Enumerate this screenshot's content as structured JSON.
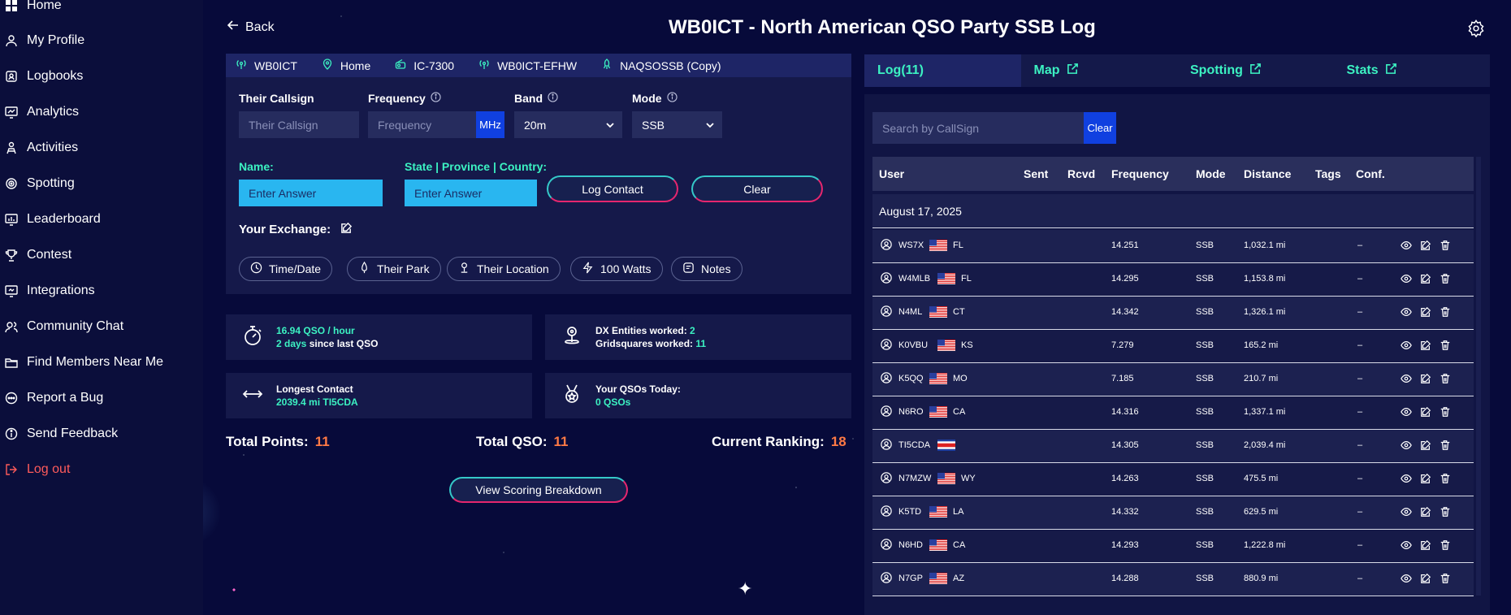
{
  "sidebar": {
    "items": [
      {
        "label": "Home",
        "icon": "home-icon"
      },
      {
        "label": "My Profile",
        "icon": "user-icon"
      },
      {
        "label": "Logbooks",
        "icon": "logbook-icon"
      },
      {
        "label": "Analytics",
        "icon": "analytics-icon"
      },
      {
        "label": "Activities",
        "icon": "activities-icon"
      },
      {
        "label": "Spotting",
        "icon": "spotting-icon"
      },
      {
        "label": "Leaderboard",
        "icon": "leaderboard-icon"
      },
      {
        "label": "Contest",
        "icon": "trophy-icon"
      },
      {
        "label": "Integrations",
        "icon": "integrations-icon"
      },
      {
        "label": "Community Chat",
        "icon": "chat-icon"
      },
      {
        "label": "Find Members Near Me",
        "icon": "folder-icon"
      },
      {
        "label": "Report a Bug",
        "icon": "bug-icon"
      },
      {
        "label": "Send Feedback",
        "icon": "info-icon"
      },
      {
        "label": "Log out",
        "icon": "logout-icon"
      }
    ]
  },
  "header": {
    "back_label": "Back",
    "title": "WB0ICT - North American QSO Party SSB Log"
  },
  "tagbar": {
    "callsign": "WB0ICT",
    "location": "Home",
    "radio": "IC-7300",
    "antenna": "WB0ICT-EFHW",
    "contest": "NAQSOSSB (Copy)"
  },
  "form": {
    "their_callsign_label": "Their Callsign",
    "their_callsign_placeholder": "Their Callsign",
    "frequency_label": "Frequency",
    "frequency_placeholder": "Frequency",
    "frequency_unit": "MHz",
    "band_label": "Band",
    "band_value": "20m",
    "mode_label": "Mode",
    "mode_value": "SSB",
    "name_label": "Name:",
    "name_placeholder": "Enter Answer",
    "state_label": "State | Province | Country:",
    "state_placeholder": "Enter Answer",
    "log_contact_label": "Log Contact",
    "clear_label": "Clear",
    "exchange_label": "Your Exchange:",
    "chips": [
      "Time/Date",
      "Their Park",
      "Their Location",
      "100 Watts",
      "Notes"
    ]
  },
  "stats": {
    "qso_rate": "16.94 QSO / hour",
    "since_days": "2 days",
    "since_suffix": "since last QSO",
    "dx_label": "DX Entities worked:",
    "dx_value": "2",
    "grid_label": "Gridsquares worked:",
    "grid_value": "11",
    "longest_label": "Longest Contact",
    "longest_value": "2039.4 mi TI5CDA",
    "today_label": "Your QSOs Today:",
    "today_value": "0 QSOs"
  },
  "totals": {
    "points_label": "Total Points:",
    "points_value": "11",
    "qso_label": "Total QSO:",
    "qso_value": "11",
    "ranking_label": "Current Ranking:",
    "ranking_value": "18"
  },
  "scoring_button": "View Scoring Breakdown",
  "tabs": [
    {
      "label": "Log(11)"
    },
    {
      "label": "Map"
    },
    {
      "label": "Spotting"
    },
    {
      "label": "Stats"
    }
  ],
  "log": {
    "search_placeholder": "Search by CallSign",
    "search_clear": "Clear",
    "columns": [
      "User",
      "Sent",
      "Rcvd",
      "Frequency",
      "Mode",
      "Distance",
      "Tags",
      "Conf."
    ],
    "date": "August 17, 2025",
    "rows": [
      {
        "call": "WS7X",
        "flag": "us",
        "state": "FL",
        "freq": "14.251",
        "mode": "SSB",
        "dist": "1,032.1 mi",
        "conf": "–"
      },
      {
        "call": "W4MLB",
        "flag": "us",
        "state": "FL",
        "freq": "14.295",
        "mode": "SSB",
        "dist": "1,153.8 mi",
        "conf": "–"
      },
      {
        "call": "N4ML",
        "flag": "us",
        "state": "CT",
        "freq": "14.342",
        "mode": "SSB",
        "dist": "1,326.1 mi",
        "conf": "–"
      },
      {
        "call": "K0VBU",
        "flag": "us",
        "state": "KS",
        "freq": "7.279",
        "mode": "SSB",
        "dist": "165.2 mi",
        "conf": "–"
      },
      {
        "call": "K5QQ",
        "flag": "us",
        "state": "MO",
        "freq": "7.185",
        "mode": "SSB",
        "dist": "210.7 mi",
        "conf": "–"
      },
      {
        "call": "N6RO",
        "flag": "us",
        "state": "CA",
        "freq": "14.316",
        "mode": "SSB",
        "dist": "1,337.1 mi",
        "conf": "–"
      },
      {
        "call": "TI5CDA",
        "flag": "cr",
        "state": "",
        "freq": "14.305",
        "mode": "SSB",
        "dist": "2,039.4 mi",
        "conf": "–"
      },
      {
        "call": "N7MZW",
        "flag": "us",
        "state": "WY",
        "freq": "14.263",
        "mode": "SSB",
        "dist": "475.5 mi",
        "conf": "–"
      },
      {
        "call": "K5TD",
        "flag": "us",
        "state": "LA",
        "freq": "14.332",
        "mode": "SSB",
        "dist": "629.5 mi",
        "conf": "–"
      },
      {
        "call": "N6HD",
        "flag": "us",
        "state": "CA",
        "freq": "14.293",
        "mode": "SSB",
        "dist": "1,222.8 mi",
        "conf": "–"
      },
      {
        "call": "N7GP",
        "flag": "us",
        "state": "AZ",
        "freq": "14.288",
        "mode": "SSB",
        "dist": "880.9 mi",
        "conf": "–"
      }
    ]
  },
  "colors": {
    "accent_cyan": "#3cf2c2",
    "accent_orange": "#ff7a45",
    "logout_red": "#ff5b5b",
    "button_blue": "#1040e0"
  }
}
